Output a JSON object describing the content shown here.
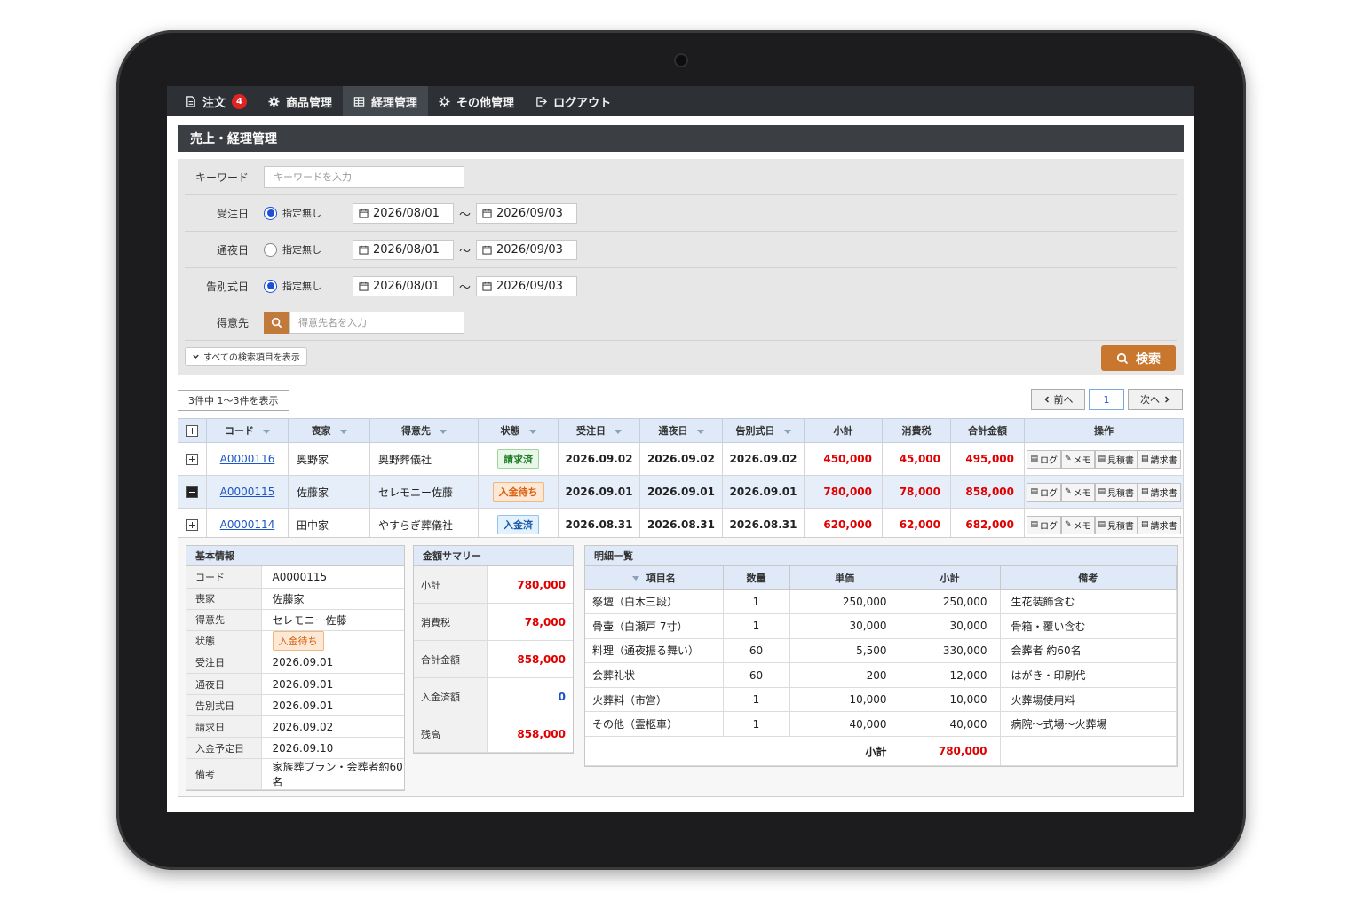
{
  "nav": {
    "items": [
      {
        "label": "注文",
        "badge": "4",
        "icon": "document-icon"
      },
      {
        "label": "商品管理",
        "icon": "gear-icon"
      },
      {
        "label": "経理管理",
        "icon": "table-icon",
        "active": true
      },
      {
        "label": "その他管理",
        "icon": "cog-icon"
      },
      {
        "label": "ログアウト",
        "icon": "logout-icon"
      }
    ]
  },
  "page": {
    "title": "売上・経理管理"
  },
  "search": {
    "keyword_label": "キーワード",
    "keyword_placeholder": "キーワードを入力",
    "order_date_label": "受注日",
    "wake_date_label": "通夜日",
    "funeral_date_label": "告別式日",
    "radio_label": "指定無し",
    "order_radio_checked": true,
    "wake_radio_checked": false,
    "funeral_radio_checked": true,
    "date_from": "2026/08/01",
    "date_to": "2026/09/03",
    "tilde": "～",
    "customer_label": "得意先",
    "customer_placeholder": "得意先名を入力",
    "show_all_label": "すべての検索項目を表示",
    "search_button": "検索",
    "accent_color": "#c9772f"
  },
  "results": {
    "count_text": "3件中 1～3件を表示",
    "prev": "前へ",
    "page": "1",
    "next": "次へ"
  },
  "table": {
    "headers": [
      "コード",
      "喪家",
      "得意先",
      "状態",
      "受注日",
      "通夜日",
      "告別式日",
      "小計",
      "消費税",
      "合計金額",
      "操作"
    ],
    "op_labels": [
      "ログ",
      "メモ",
      "見積書",
      "請求書"
    ],
    "rows": [
      {
        "code": "A0000116",
        "family": "奥野家",
        "customer": "奥野葬儀社",
        "status": "請求済",
        "status_color": "green",
        "order": "2026.09.02",
        "wake": "2026.09.02",
        "funeral": "2026.09.02",
        "subtotal": "450,000",
        "tax": "45,000",
        "total": "495,000",
        "expanded": false
      },
      {
        "code": "A0000115",
        "family": "佐藤家",
        "customer": "セレモニー佐藤",
        "status": "入金待ち",
        "status_color": "orange",
        "order": "2026.09.01",
        "wake": "2026.09.01",
        "funeral": "2026.09.01",
        "subtotal": "780,000",
        "tax": "78,000",
        "total": "858,000",
        "expanded": true
      },
      {
        "code": "A0000114",
        "family": "田中家",
        "customer": "やすらぎ葬儀社",
        "status": "入金済",
        "status_color": "blue",
        "order": "2026.08.31",
        "wake": "2026.08.31",
        "funeral": "2026.08.31",
        "subtotal": "620,000",
        "tax": "62,000",
        "total": "682,000",
        "expanded": false
      }
    ]
  },
  "basic_info": {
    "title": "基本情報",
    "fields": [
      {
        "k": "コード",
        "v": "A0000115"
      },
      {
        "k": "喪家",
        "v": "佐藤家"
      },
      {
        "k": "得意先",
        "v": "セレモニー佐藤"
      },
      {
        "k": "状態",
        "v": "入金待ち",
        "badge": true
      },
      {
        "k": "受注日",
        "v": "2026.09.01"
      },
      {
        "k": "通夜日",
        "v": "2026.09.01"
      },
      {
        "k": "告別式日",
        "v": "2026.09.01"
      },
      {
        "k": "請求日",
        "v": "2026.09.02"
      },
      {
        "k": "入金予定日",
        "v": "2026.09.10"
      },
      {
        "k": "備考",
        "v": "家族葬プラン・会葬者約60名"
      }
    ]
  },
  "summary": {
    "title": "金額サマリー",
    "rows": [
      {
        "k": "小計",
        "v": "780,000",
        "color": "red"
      },
      {
        "k": "消費税",
        "v": "78,000",
        "color": "red"
      },
      {
        "k": "合計金額",
        "v": "858,000",
        "color": "red"
      },
      {
        "k": "入金済額",
        "v": "0",
        "color": "blue"
      },
      {
        "k": "残高",
        "v": "858,000",
        "color": "red"
      }
    ]
  },
  "line_items": {
    "title": "明細一覧",
    "headers": [
      "項目名",
      "数量",
      "単価",
      "小計",
      "備考"
    ],
    "rows": [
      {
        "name": "祭壇（白木三段）",
        "qty": "1",
        "price": "250,000",
        "sub": "250,000",
        "note": "生花装飾含む"
      },
      {
        "name": "骨壷（白瀬戸 7寸）",
        "qty": "1",
        "price": "30,000",
        "sub": "30,000",
        "note": "骨箱・覆い含む"
      },
      {
        "name": "料理（通夜振る舞い）",
        "qty": "60",
        "price": "5,500",
        "sub": "330,000",
        "note": "会葬者 約60名"
      },
      {
        "name": "会葬礼状",
        "qty": "60",
        "price": "200",
        "sub": "12,000",
        "note": "はがき・印刷代"
      },
      {
        "name": "火葬料（市営）",
        "qty": "1",
        "price": "10,000",
        "sub": "10,000",
        "note": "火葬場使用料"
      },
      {
        "name": "その他（霊柩車）",
        "qty": "1",
        "price": "40,000",
        "sub": "40,000",
        "note": "病院～式場～火葬場"
      }
    ],
    "subtotal_label": "小計",
    "subtotal_value": "780,000"
  }
}
